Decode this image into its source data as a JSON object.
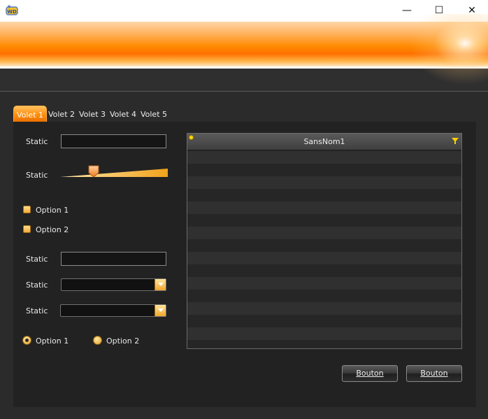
{
  "window": {
    "app_icon": "windev-app-icon",
    "controls": {
      "minimize": "—",
      "maximize": "☐",
      "close": "✕"
    }
  },
  "tabs": [
    {
      "label": "Volet 1",
      "active": true
    },
    {
      "label": "Volet 2",
      "active": false
    },
    {
      "label": "Volet 3",
      "active": false
    },
    {
      "label": "Volet 4",
      "active": false
    },
    {
      "label": "Volet 5",
      "active": false
    }
  ],
  "form": {
    "static1_label": "Static",
    "static1_value": "",
    "slider_label": "Static",
    "slider_value": 0.29,
    "checkbox1_label": "Option 1",
    "checkbox2_label": "Option 2",
    "static2_label": "Static",
    "static2_value": "",
    "combo1_label": "Static",
    "combo1_value": "",
    "combo2_label": "Static",
    "combo2_value": "",
    "radio1_label": "Option 1",
    "radio2_label": "Option 2",
    "radio_selected": "Option 1"
  },
  "table": {
    "column_header": "SansNom1",
    "rows": []
  },
  "buttons": {
    "button1_label": "Bouton",
    "button2_label": "Bouton"
  },
  "colors": {
    "accent": "#ff8a00",
    "panel_bg": "#222222",
    "window_bg": "#2b2b2b"
  }
}
